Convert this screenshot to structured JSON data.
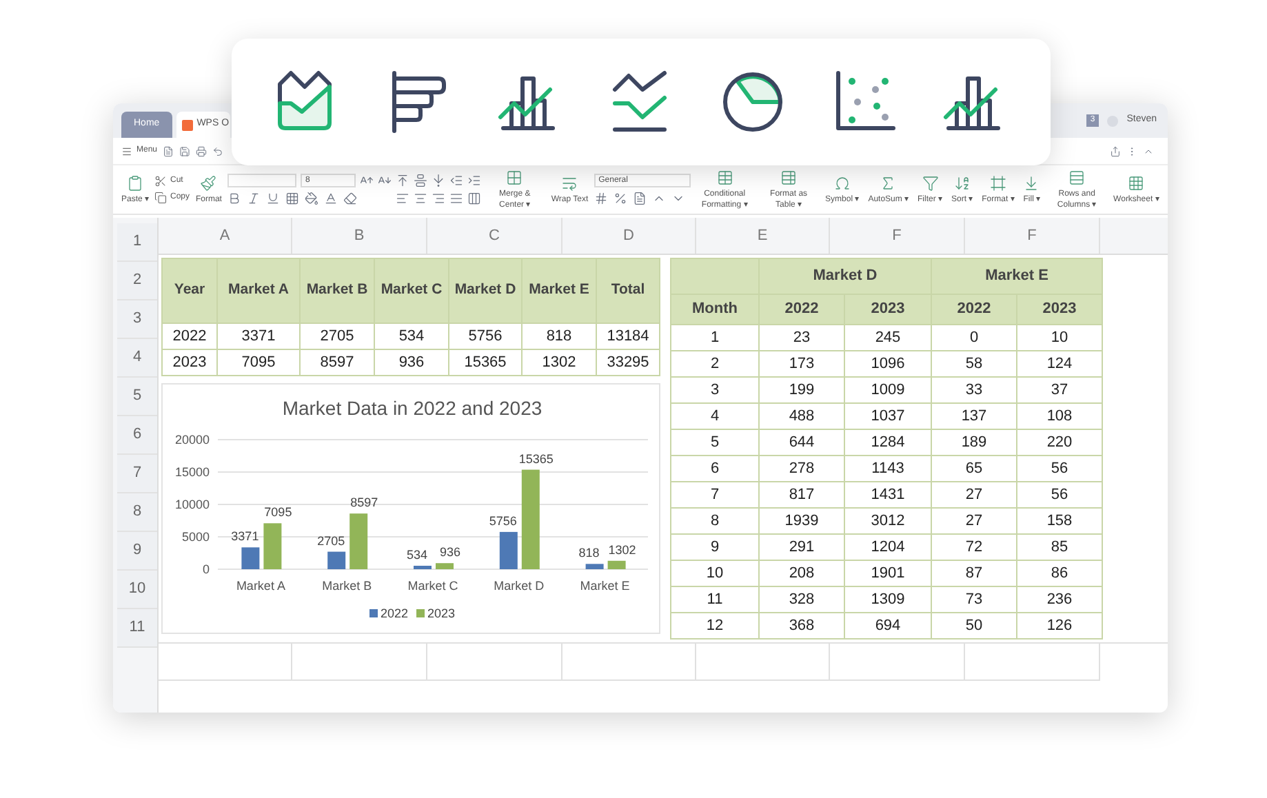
{
  "tabs": [
    {
      "label": "Home",
      "selected": true
    },
    {
      "label": "WPS O",
      "selected": false
    }
  ],
  "account": {
    "badge": "3",
    "name": "Steven"
  },
  "menu": {
    "label": "Menu"
  },
  "ribbon": [
    {
      "kind": "big",
      "label": "Paste ▾"
    },
    {
      "kind": "pair",
      "labels": [
        "Cut",
        "Copy"
      ]
    },
    {
      "kind": "big",
      "label": "Format"
    },
    {
      "kind": "font",
      "size": "8"
    },
    {
      "kind": "align"
    },
    {
      "kind": "big",
      "label": "Merge & Center ▾"
    },
    {
      "kind": "big",
      "label": "Wrap Text"
    },
    {
      "kind": "number",
      "format": "General"
    },
    {
      "kind": "big",
      "label": "Conditional Formatting ▾"
    },
    {
      "kind": "big",
      "label": "Format as Table ▾"
    },
    {
      "kind": "big",
      "label": "Symbol ▾"
    },
    {
      "kind": "big",
      "label": "AutoSum ▾"
    },
    {
      "kind": "big",
      "label": "Filter ▾"
    },
    {
      "kind": "big",
      "label": "Sort ▾"
    },
    {
      "kind": "big",
      "label": "Format ▾"
    },
    {
      "kind": "big",
      "label": "Fill ▾"
    },
    {
      "kind": "big",
      "label": "Rows and Columns ▾"
    },
    {
      "kind": "big",
      "label": "Worksheet ▾"
    }
  ],
  "column_headers": [
    "A",
    "B",
    "C",
    "D",
    "E",
    "F",
    "F"
  ],
  "row_headers": [
    "1",
    "2",
    "3",
    "4",
    "5",
    "6",
    "7",
    "8",
    "9",
    "10",
    "11"
  ],
  "summary_table": {
    "columns": [
      "Year",
      "Market A",
      "Market B",
      "Market C",
      "Market D",
      "Market E",
      "Total"
    ],
    "rows": [
      [
        "2022",
        "3371",
        "2705",
        "534",
        "5756",
        "818",
        "13184"
      ],
      [
        "2023",
        "7095",
        "8597",
        "936",
        "15365",
        "1302",
        "33295"
      ]
    ]
  },
  "chart": {
    "chart_data": {
      "type": "bar",
      "title": "Market Data in 2022 and 2023",
      "categories": [
        "Market A",
        "Market B",
        "Market C",
        "Market D",
        "Market E"
      ],
      "series": [
        {
          "name": "2022",
          "color": "#4e79b5",
          "values": [
            3371,
            2705,
            534,
            5756,
            818
          ]
        },
        {
          "name": "2023",
          "color": "#92b558",
          "values": [
            7095,
            8597,
            936,
            15365,
            1302
          ]
        }
      ],
      "ylim": [
        0,
        20000
      ],
      "yticks": [
        0,
        5000,
        10000,
        15000,
        20000
      ],
      "data_labels": true,
      "grid": true,
      "legend": true
    }
  },
  "monthly_table": {
    "groups": [
      "Market D",
      "Market E"
    ],
    "columns": [
      "Month",
      "2022",
      "2023",
      "2022",
      "2023"
    ],
    "rows": [
      [
        "1",
        "23",
        "245",
        "0",
        "10"
      ],
      [
        "2",
        "173",
        "1096",
        "58",
        "124"
      ],
      [
        "3",
        "199",
        "1009",
        "33",
        "37"
      ],
      [
        "4",
        "488",
        "1037",
        "137",
        "108"
      ],
      [
        "5",
        "644",
        "1284",
        "189",
        "220"
      ],
      [
        "6",
        "278",
        "1143",
        "65",
        "56"
      ],
      [
        "7",
        "817",
        "1431",
        "27",
        "56"
      ],
      [
        "8",
        "1939",
        "3012",
        "27",
        "158"
      ],
      [
        "9",
        "291",
        "1204",
        "72",
        "85"
      ],
      [
        "10",
        "208",
        "1901",
        "87",
        "86"
      ],
      [
        "11",
        "328",
        "1309",
        "73",
        "236"
      ],
      [
        "12",
        "368",
        "694",
        "50",
        "126"
      ]
    ]
  }
}
